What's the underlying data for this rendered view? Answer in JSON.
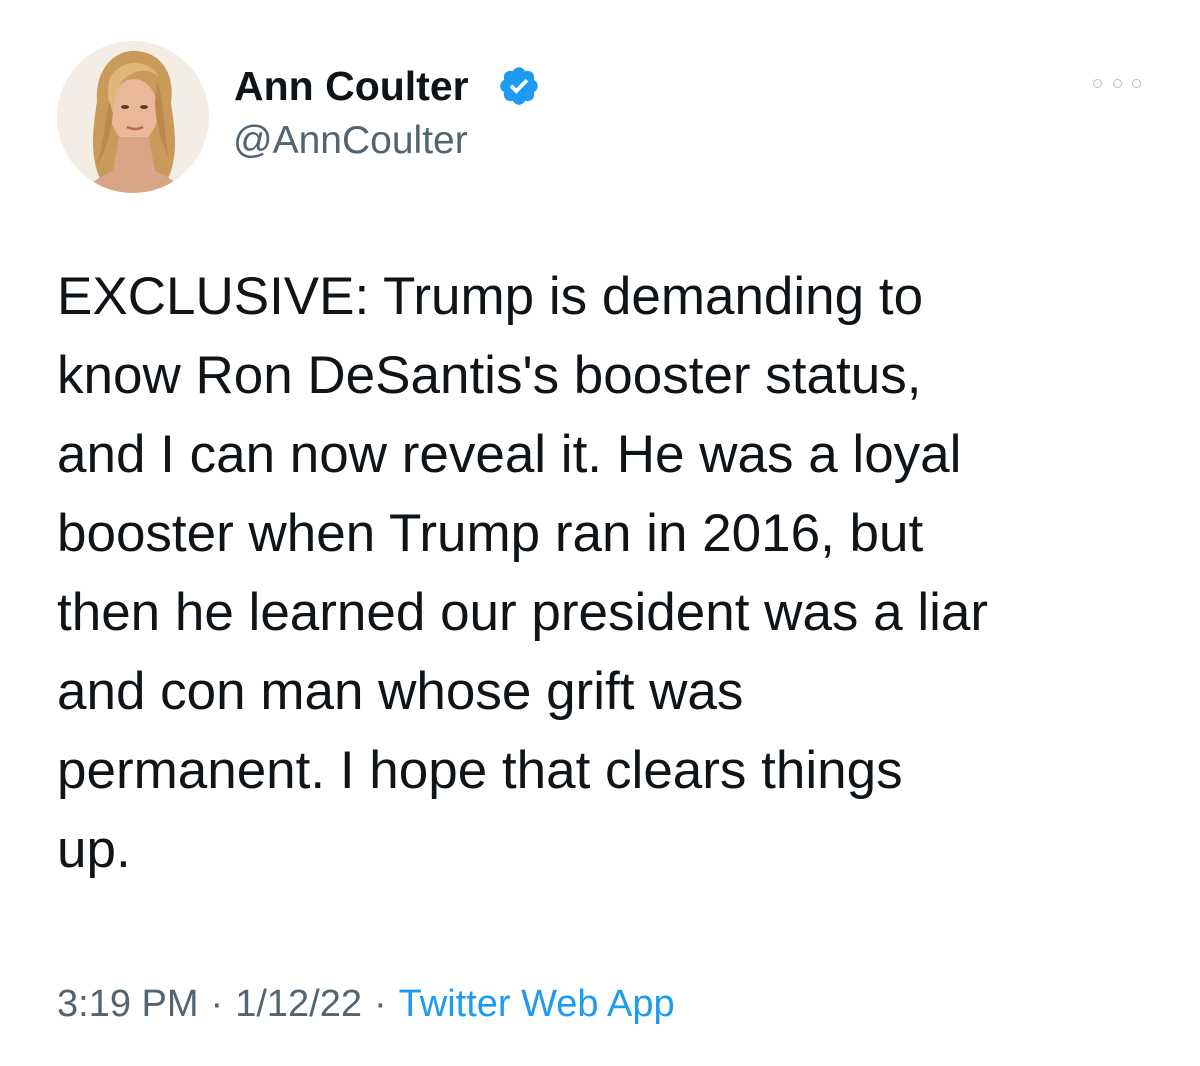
{
  "author": {
    "display_name": "Ann Coulter",
    "handle": "@AnnCoulter",
    "verified_color": "#1d9bf0"
  },
  "icons": {
    "verified": "verified-badge-icon",
    "more": "more-options-icon"
  },
  "tweet": {
    "lines": [
      "EXCLUSIVE: Trump is demanding to",
      "know Ron DeSantis's booster status,",
      "and I can now reveal it. He was a loyal",
      "booster when Trump ran in 2016, but",
      "then he learned our president was a liar",
      "and con man whose grift was",
      "permanent. I hope that clears things",
      "up."
    ]
  },
  "meta": {
    "time": "3:19 PM",
    "separator": "·",
    "date": "1/12/22",
    "source": "Twitter Web App"
  },
  "colors": {
    "text": "#0f1419",
    "secondary": "#536471",
    "link": "#1d9bf0"
  }
}
